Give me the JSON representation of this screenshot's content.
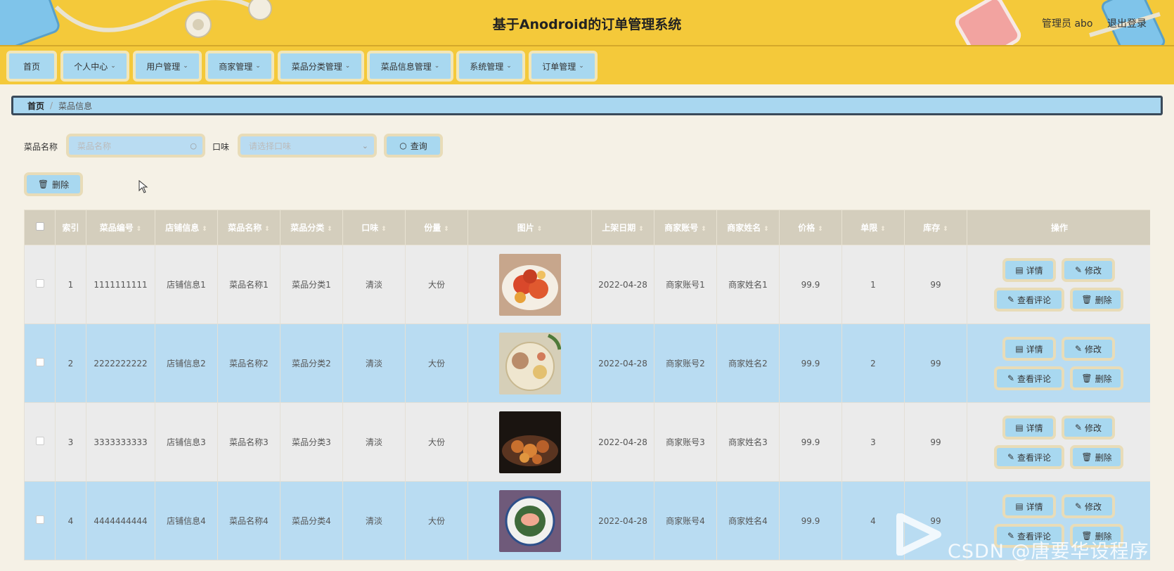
{
  "header": {
    "title": "基于Anodroid的订单管理系统",
    "admin_label": "管理员 abo",
    "logout_label": "退出登录"
  },
  "nav": {
    "items": [
      {
        "label": "首页"
      },
      {
        "label": "个人中心"
      },
      {
        "label": "用户管理"
      },
      {
        "label": "商家管理"
      },
      {
        "label": "菜品分类管理"
      },
      {
        "label": "菜品信息管理"
      },
      {
        "label": "系统管理"
      },
      {
        "label": "订单管理"
      }
    ]
  },
  "breadcrumb": {
    "home": "首页",
    "separator": "/",
    "current": "菜品信息"
  },
  "search": {
    "name_label": "菜品名称",
    "name_placeholder": "菜品名称",
    "taste_label": "口味",
    "taste_placeholder": "请选择口味",
    "query_label": "查询",
    "delete_label": "删除"
  },
  "table": {
    "headers": [
      "索引",
      "菜品编号",
      "店铺信息",
      "菜品名称",
      "菜品分类",
      "口味",
      "份量",
      "图片",
      "上架日期",
      "商家账号",
      "商家姓名",
      "价格",
      "单限",
      "库存",
      "操作"
    ],
    "rows": [
      {
        "index": "1",
        "code": "1111111111",
        "shop": "店铺信息1",
        "name": "菜品名称1",
        "category": "菜品分类1",
        "taste": "清淡",
        "portion": "大份",
        "date": "2022-04-28",
        "account": "商家账号1",
        "merchant": "商家姓名1",
        "price": "99.9",
        "limit": "1",
        "stock": "99"
      },
      {
        "index": "2",
        "code": "2222222222",
        "shop": "店铺信息2",
        "name": "菜品名称2",
        "category": "菜品分类2",
        "taste": "清淡",
        "portion": "大份",
        "date": "2022-04-28",
        "account": "商家账号2",
        "merchant": "商家姓名2",
        "price": "99.9",
        "limit": "2",
        "stock": "99"
      },
      {
        "index": "3",
        "code": "3333333333",
        "shop": "店铺信息3",
        "name": "菜品名称3",
        "category": "菜品分类3",
        "taste": "清淡",
        "portion": "大份",
        "date": "2022-04-28",
        "account": "商家账号3",
        "merchant": "商家姓名3",
        "price": "99.9",
        "limit": "3",
        "stock": "99"
      },
      {
        "index": "4",
        "code": "4444444444",
        "shop": "店铺信息4",
        "name": "菜品名称4",
        "category": "菜品分类4",
        "taste": "清淡",
        "portion": "大份",
        "date": "2022-04-28",
        "account": "商家账号4",
        "merchant": "商家姓名4",
        "price": "99.9",
        "limit": "4",
        "stock": "99"
      }
    ],
    "actions": {
      "detail": "详情",
      "edit": "修改",
      "comments": "查看评论",
      "delete": "删除"
    }
  },
  "watermark": "CSDN @唐要华设程序",
  "colors": {
    "header": "#f4c93a",
    "button": "#a8d8f0",
    "row_alt": "#b9dcf2",
    "table_head": "#d4cebd"
  }
}
